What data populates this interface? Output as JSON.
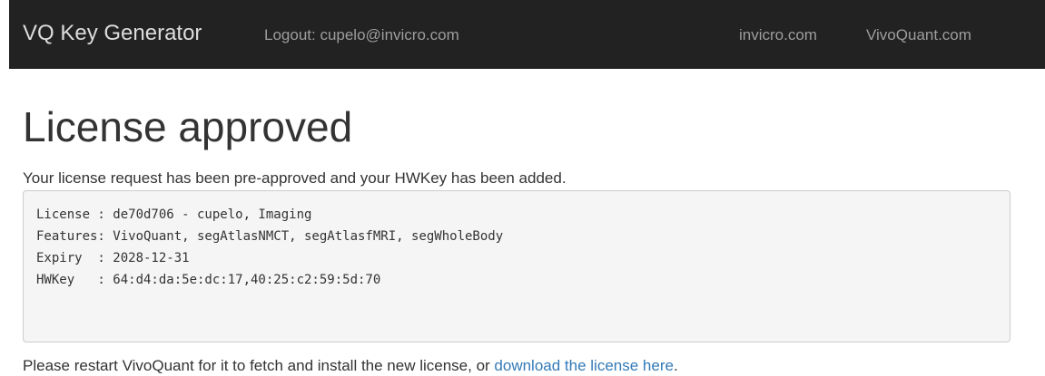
{
  "navbar": {
    "brand": "VQ Key Generator",
    "logout": "Logout: cupelo@invicro.com",
    "links": [
      "invicro.com",
      "VivoQuant.com"
    ]
  },
  "main": {
    "title": "License approved",
    "intro": "Your license request has been pre-approved and your HWKey has been added.",
    "license_lines": [
      "License : de70d706 - cupelo, Imaging",
      "Features: VivoQuant, segAtlasNMCT, segAtlasfMRI, segWholeBody",
      "Expiry  : 2028-12-31",
      "HWKey   : 64:d4:da:5e:dc:17,40:25:c2:59:5d:70"
    ],
    "restart_text": "Please restart VivoQuant for it to fetch and install the new license, or ",
    "download_link": "download the license here",
    "restart_suffix": "."
  },
  "colors": {
    "navbar_bg": "#222222",
    "link": "#337ab7",
    "code_bg": "#f5f5f5"
  }
}
